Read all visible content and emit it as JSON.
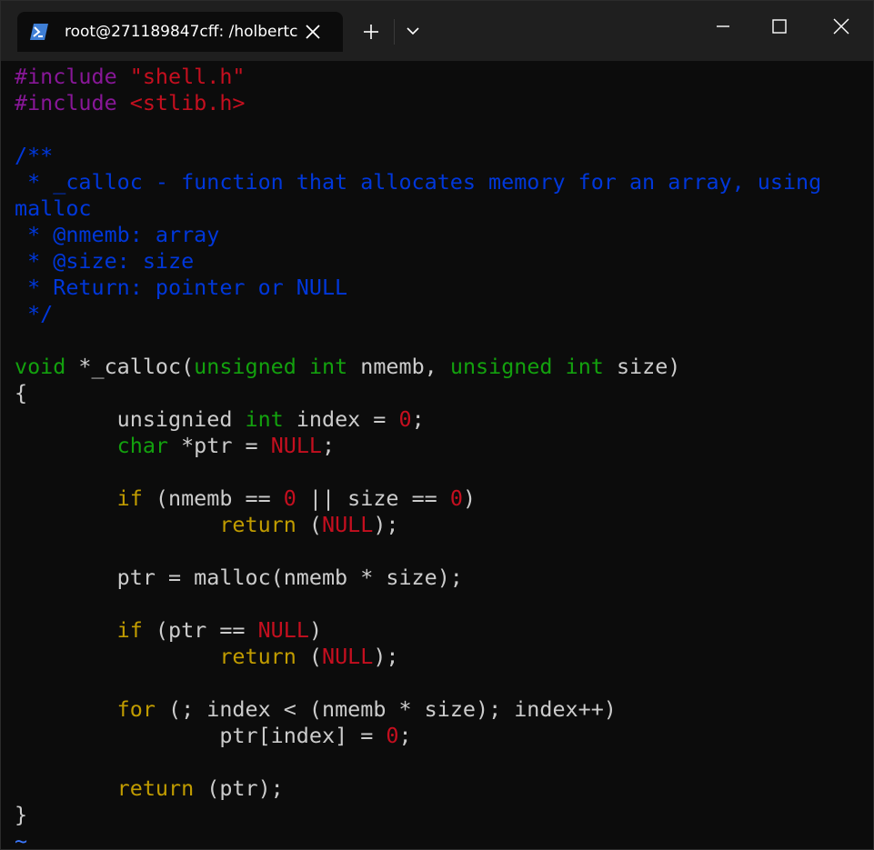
{
  "tab": {
    "title": "root@271189847cff: /holbertc",
    "icon": "powershell-icon"
  },
  "window_controls": {
    "new_tab": "+",
    "dropdown": "chevron-down",
    "minimize": "minimize",
    "maximize": "maximize",
    "close": "close"
  },
  "colors": {
    "background": "#0c0c0c",
    "titlebar": "#1f1f1f",
    "preprocessor": "#881798",
    "string": "#c50f1f",
    "comment": "#0037da",
    "type": "#13a10e",
    "keyword": "#c19c00",
    "number": "#c50f1f",
    "text": "#cccccc",
    "tilde": "#3b78ff"
  },
  "code": [
    [
      {
        "t": "#include ",
        "c": "pre"
      },
      {
        "t": "\"shell.h\"",
        "c": "str"
      }
    ],
    [
      {
        "t": "#include ",
        "c": "pre"
      },
      {
        "t": "<stlib.h>",
        "c": "str"
      }
    ],
    [],
    [
      {
        "t": "/**",
        "c": "com"
      }
    ],
    [
      {
        "t": " * _calloc - function that allocates memory for an array, using",
        "c": "com"
      }
    ],
    [
      {
        "t": "malloc",
        "c": "com"
      }
    ],
    [
      {
        "t": " * @nmemb: array",
        "c": "com"
      }
    ],
    [
      {
        "t": " * @size: size",
        "c": "com"
      }
    ],
    [
      {
        "t": " * Return: pointer or NULL",
        "c": "com"
      }
    ],
    [
      {
        "t": " */",
        "c": "com"
      }
    ],
    [],
    [
      {
        "t": "void",
        "c": "typ"
      },
      {
        "t": " *_calloc(",
        "c": "txt"
      },
      {
        "t": "unsigned",
        "c": "typ"
      },
      {
        "t": " ",
        "c": "txt"
      },
      {
        "t": "int",
        "c": "typ"
      },
      {
        "t": " nmemb, ",
        "c": "txt"
      },
      {
        "t": "unsigned",
        "c": "typ"
      },
      {
        "t": " ",
        "c": "txt"
      },
      {
        "t": "int",
        "c": "typ"
      },
      {
        "t": " size)",
        "c": "txt"
      }
    ],
    [
      {
        "t": "{",
        "c": "txt"
      }
    ],
    [
      {
        "t": "        unsignied ",
        "c": "txt"
      },
      {
        "t": "int",
        "c": "typ"
      },
      {
        "t": " index = ",
        "c": "txt"
      },
      {
        "t": "0",
        "c": "num"
      },
      {
        "t": ";",
        "c": "txt"
      }
    ],
    [
      {
        "t": "        ",
        "c": "txt"
      },
      {
        "t": "char",
        "c": "typ"
      },
      {
        "t": " *ptr = ",
        "c": "txt"
      },
      {
        "t": "NULL",
        "c": "num"
      },
      {
        "t": ";",
        "c": "txt"
      }
    ],
    [],
    [
      {
        "t": "        ",
        "c": "txt"
      },
      {
        "t": "if",
        "c": "kw"
      },
      {
        "t": " (nmemb == ",
        "c": "txt"
      },
      {
        "t": "0",
        "c": "num"
      },
      {
        "t": " || size == ",
        "c": "txt"
      },
      {
        "t": "0",
        "c": "num"
      },
      {
        "t": ")",
        "c": "txt"
      }
    ],
    [
      {
        "t": "                ",
        "c": "txt"
      },
      {
        "t": "return",
        "c": "kw"
      },
      {
        "t": " (",
        "c": "txt"
      },
      {
        "t": "NULL",
        "c": "num"
      },
      {
        "t": ");",
        "c": "txt"
      }
    ],
    [],
    [
      {
        "t": "        ptr = malloc(nmemb * size);",
        "c": "txt"
      }
    ],
    [],
    [
      {
        "t": "        ",
        "c": "txt"
      },
      {
        "t": "if",
        "c": "kw"
      },
      {
        "t": " (ptr == ",
        "c": "txt"
      },
      {
        "t": "NULL",
        "c": "num"
      },
      {
        "t": ")",
        "c": "txt"
      }
    ],
    [
      {
        "t": "                ",
        "c": "txt"
      },
      {
        "t": "return",
        "c": "kw"
      },
      {
        "t": " (",
        "c": "txt"
      },
      {
        "t": "NULL",
        "c": "num"
      },
      {
        "t": ");",
        "c": "txt"
      }
    ],
    [],
    [
      {
        "t": "        ",
        "c": "txt"
      },
      {
        "t": "for",
        "c": "kw"
      },
      {
        "t": " (; index < (nmemb * size); index++)",
        "c": "txt"
      }
    ],
    [
      {
        "t": "                ptr[index] = ",
        "c": "txt"
      },
      {
        "t": "0",
        "c": "num"
      },
      {
        "t": ";",
        "c": "txt"
      }
    ],
    [],
    [
      {
        "t": "        ",
        "c": "txt"
      },
      {
        "t": "return",
        "c": "kw"
      },
      {
        "t": " (ptr);",
        "c": "txt"
      }
    ],
    [
      {
        "t": "}",
        "c": "txt"
      }
    ]
  ],
  "tilde": "~"
}
